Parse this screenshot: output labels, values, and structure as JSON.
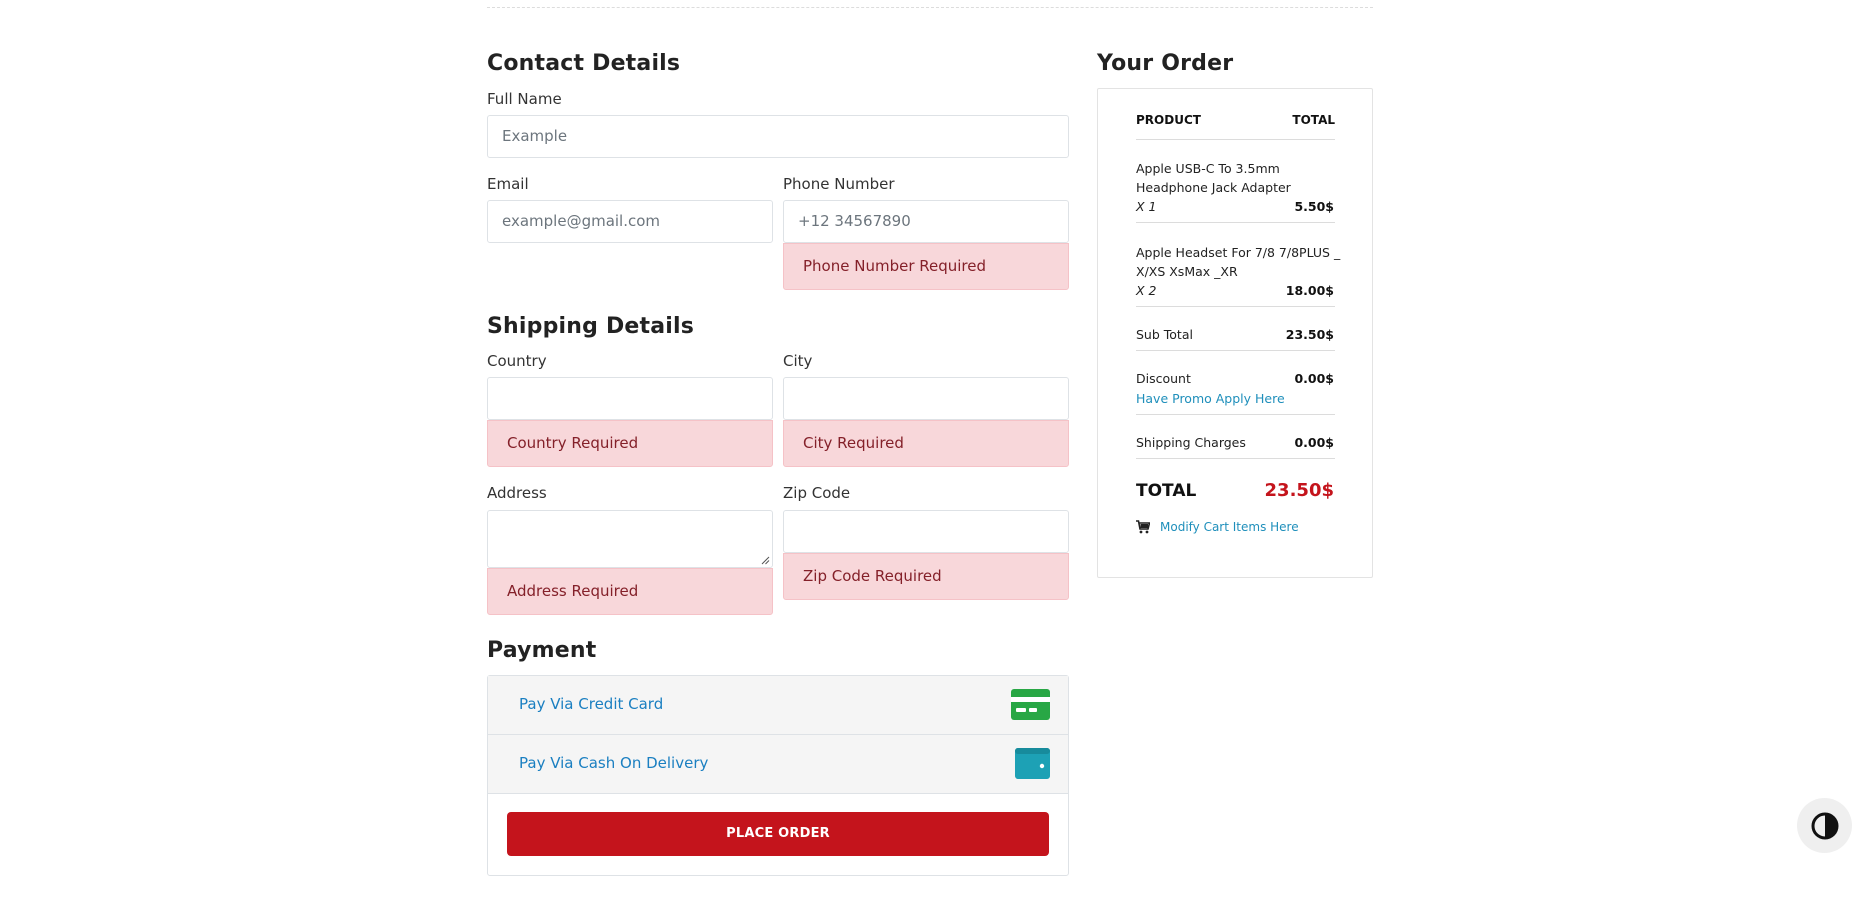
{
  "contact": {
    "title": "Contact Details",
    "full_name_label": "Full Name",
    "full_name_placeholder": "Example",
    "email_label": "Email",
    "email_placeholder": "example@gmail.com",
    "phone_label": "Phone Number",
    "phone_placeholder": "+12 34567890",
    "phone_error": "Phone Number Required"
  },
  "shipping": {
    "title": "Shipping Details",
    "country_label": "Country",
    "country_error": "Country Required",
    "city_label": "City",
    "city_error": "City Required",
    "address_label": "Address",
    "address_error": "Address Required",
    "zip_label": "Zip Code",
    "zip_error": "Zip Code Required"
  },
  "payment": {
    "title": "Payment",
    "options": [
      {
        "label": "Pay Via Credit Card",
        "icon": "credit-card-icon",
        "color": "#28a745"
      },
      {
        "label": "Pay Via Cash On Delivery",
        "icon": "wallet-icon",
        "color": "#1da1b5"
      }
    ],
    "place_order_label": "PLACE ORDER"
  },
  "order": {
    "title": "Your Order",
    "col_product": "PRODUCT",
    "col_total": "TOTAL",
    "items": [
      {
        "name_line1": "Apple USB-C To 3.5mm",
        "name_line2": "Headphone Jack Adapter",
        "qty": "X 1",
        "price": "5.50$"
      },
      {
        "name_line1": "Apple Headset For 7/8 7/8PLUS _",
        "name_line2": "X/XS XsMax _XR",
        "qty": "X 2",
        "price": "18.00$"
      }
    ],
    "subtotal_label": "Sub Total",
    "subtotal_value": "23.50$",
    "discount_label": "Discount",
    "discount_value": "0.00$",
    "promo_link": "Have Promo Apply Here",
    "shipping_label": "Shipping Charges",
    "shipping_value": "0.00$",
    "total_label": "TOTAL",
    "total_value": "23.50$",
    "modify_link": "Modify Cart Items Here"
  },
  "colors": {
    "accent": "#c4141c",
    "link": "#1a7fc1",
    "error_bg": "#f8d7da",
    "error_text": "#842029"
  },
  "icons": {
    "theme_toggle": "contrast-icon",
    "cart": "cart-icon"
  }
}
